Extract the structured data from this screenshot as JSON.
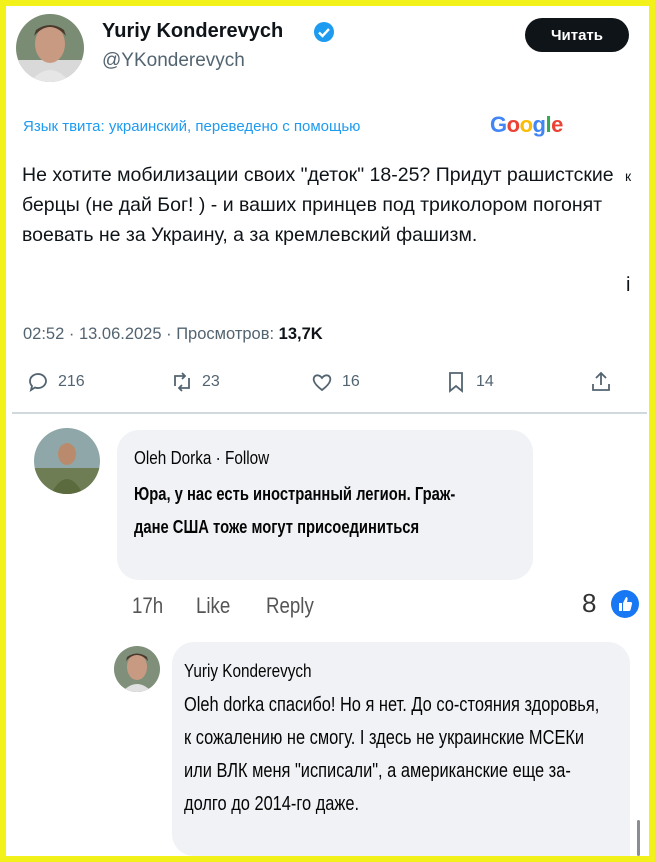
{
  "tweet": {
    "author_name": "Yuriy Konderevych",
    "author_handle": "@YKonderevych",
    "read_button": "Читать",
    "translation_note": "Язык твита: украинский, переведено с помощью",
    "google_logo": "Google",
    "text": "Не хотите мобилизации своих \"деток\" 18-25? Придут рашистские берцы (не дай Бог! ) - и ваших принцев под триколором погонят воевать не за Украину, а за кремлевский фашизм.",
    "edge_char_1": "к",
    "edge_char_2": "і",
    "time_date": "02:52 · 13.06.2025 · Просмотров: ",
    "views": "13,7K",
    "replies": "216",
    "retweets": "23",
    "likes": "16",
    "bookmarks": "14"
  },
  "comment1": {
    "author": "Oleh Dorka · Follow",
    "text": "Юра, у нас есть иностранный легион. Граж-дане США тоже могут присоединиться",
    "time": "17h",
    "like_label": "Like",
    "reply_label": "Reply",
    "reactions": "8"
  },
  "comment2": {
    "author": "Yuriy Konderevych",
    "text": "Oleh dorka спасибо! Но я нет. До со-стояния здоровья, к сожалению не смогу. I здесь не украинские МСЕКи или ВЛК меня \"исписали\", а американские еще за-долго до 2014-го даже."
  },
  "colors": {
    "border": "#f2f21a",
    "twitter_blue": "#1d9bf0",
    "fb_blue": "#1877f2"
  }
}
